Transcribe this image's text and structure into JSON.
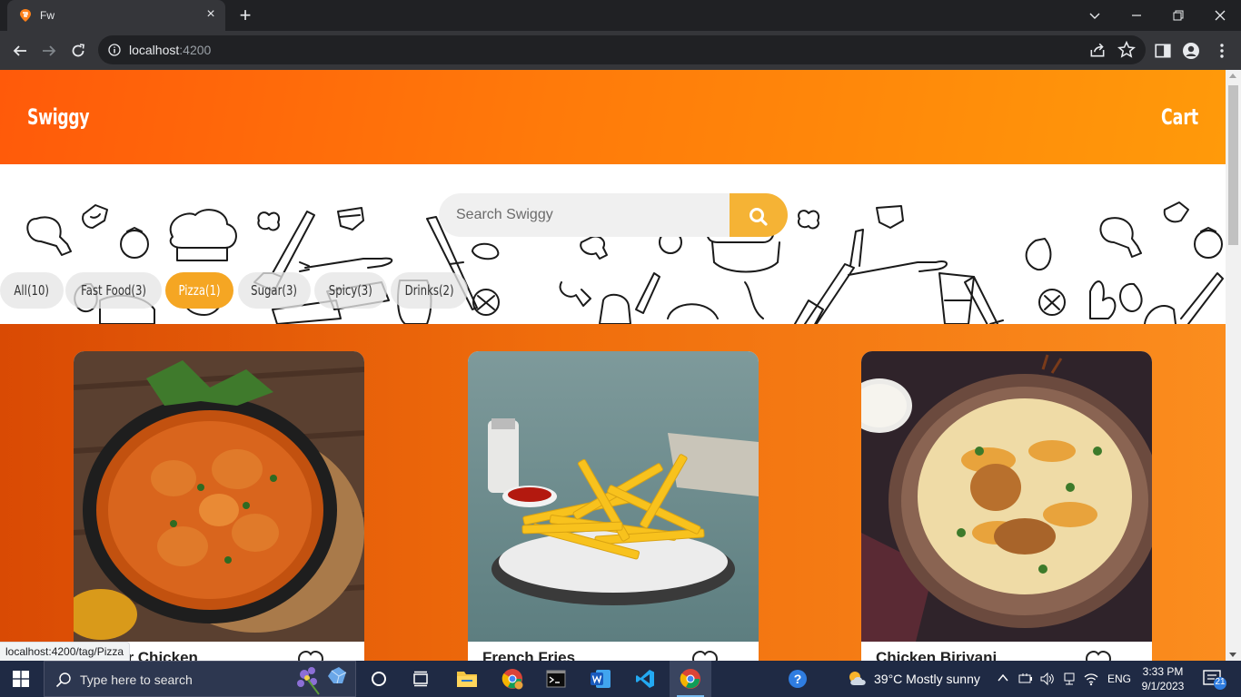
{
  "browser": {
    "tab_title": "Fw",
    "url_host": "localhost",
    "url_port": ":4200",
    "hover_link": "localhost:4200/tag/Pizza"
  },
  "site": {
    "brand": "Swiggy",
    "cart_label": "Cart",
    "accent_color": "#ff6a0a",
    "search": {
      "placeholder": "Search Swiggy"
    },
    "tags": [
      {
        "label": "All(10)",
        "active": false
      },
      {
        "label": "Fast Food(3)",
        "active": false
      },
      {
        "label": "Pizza(1)",
        "active": true
      },
      {
        "label": "Sugar(3)",
        "active": false
      },
      {
        "label": "Spicy(3)",
        "active": false
      },
      {
        "label": "Drinks(2)",
        "active": false
      }
    ],
    "foods": [
      {
        "name": "Butter Chicken",
        "image": "butter-chicken-photo"
      },
      {
        "name": "French Fries",
        "image": "french-fries-photo"
      },
      {
        "name": "Chicken Biriyani",
        "image": "chicken-biriyani-photo"
      }
    ]
  },
  "taskbar": {
    "search_placeholder": "Type here to search",
    "weather": "39°C  Mostly sunny",
    "language": "ENG",
    "time": "3:33 PM",
    "date": "9/1/2023",
    "notification_count": "21"
  }
}
